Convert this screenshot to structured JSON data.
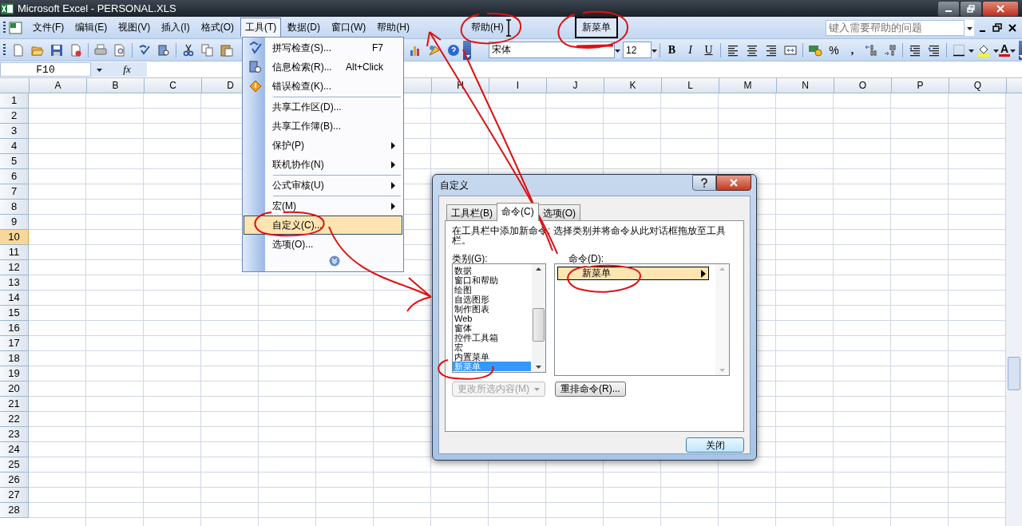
{
  "window": {
    "title": "Microsoft Excel - PERSONAL.XLS"
  },
  "menu_bar": {
    "items": [
      {
        "label": "文件(F)",
        "selected": false
      },
      {
        "label": "编辑(E)",
        "selected": false
      },
      {
        "label": "视图(V)",
        "selected": false
      },
      {
        "label": "插入(I)",
        "selected": false
      },
      {
        "label": "格式(O)",
        "selected": false
      },
      {
        "label": "工具(T)",
        "selected": true
      },
      {
        "label": "数据(D)",
        "selected": false
      },
      {
        "label": "窗口(W)",
        "selected": false
      },
      {
        "label": "帮助(H)",
        "selected": false
      }
    ],
    "custom_items": [
      {
        "label": "帮助(H)",
        "selected": false
      },
      {
        "label": "新菜单",
        "selected": true
      }
    ],
    "help_search": {
      "placeholder": "键入需要帮助的问题"
    }
  },
  "formatting_toolbar": {
    "font": "宋体",
    "size": "12",
    "bold": "B",
    "italic": "I",
    "underline": "U",
    "percent": "%",
    "comma": ",",
    "font_color": "A"
  },
  "formula_bar": {
    "name_box": "F10",
    "function_label": "fx"
  },
  "sheet": {
    "columns": [
      "A",
      "B",
      "C",
      "D",
      null,
      null,
      null,
      "H",
      "I",
      "J",
      "K",
      "L",
      "M",
      "N",
      "O",
      "P",
      "Q"
    ],
    "rows": [
      {
        "label": "1",
        "selected": false
      },
      {
        "label": "2",
        "selected": false
      },
      {
        "label": "3",
        "selected": false
      },
      {
        "label": "4",
        "selected": false
      },
      {
        "label": "5",
        "selected": false
      },
      {
        "label": "6",
        "selected": false
      },
      {
        "label": "7",
        "selected": false
      },
      {
        "label": "8",
        "selected": false
      },
      {
        "label": "9",
        "selected": false
      },
      {
        "label": "10",
        "selected": true
      },
      {
        "label": "11",
        "selected": false
      },
      {
        "label": "12",
        "selected": false
      },
      {
        "label": "13",
        "selected": false
      },
      {
        "label": "14",
        "selected": false
      },
      {
        "label": "15",
        "selected": false
      },
      {
        "label": "16",
        "selected": false
      },
      {
        "label": "17",
        "selected": false
      },
      {
        "label": "18",
        "selected": false
      },
      {
        "label": "19",
        "selected": false
      },
      {
        "label": "20",
        "selected": false
      },
      {
        "label": "21",
        "selected": false
      },
      {
        "label": "22",
        "selected": false
      },
      {
        "label": "23",
        "selected": false
      },
      {
        "label": "24",
        "selected": false
      },
      {
        "label": "25",
        "selected": false
      },
      {
        "label": "26",
        "selected": false
      },
      {
        "label": "27",
        "selected": false
      },
      {
        "label": "28",
        "selected": false
      }
    ]
  },
  "tools_menu": {
    "items": [
      {
        "label": "拼写检查(S)...",
        "shortcut": "F7",
        "submenu": false,
        "separator_before": false,
        "selected": false
      },
      {
        "label": "信息检索(R)...",
        "shortcut": "Alt+Click",
        "submenu": false,
        "separator_before": false,
        "selected": false
      },
      {
        "label": "错误检查(K)...",
        "submenu": false,
        "separator_before": false,
        "selected": false
      },
      {
        "label": "共享工作区(D)...",
        "submenu": false,
        "separator_before": true,
        "selected": false
      },
      {
        "label": "共享工作簿(B)...",
        "submenu": false,
        "separator_before": false,
        "selected": false
      },
      {
        "label": "保护(P)",
        "submenu": true,
        "separator_before": false,
        "selected": false
      },
      {
        "label": "联机协作(N)",
        "submenu": true,
        "separator_before": false,
        "selected": false
      },
      {
        "label": "公式审核(U)",
        "submenu": true,
        "separator_before": true,
        "selected": false
      },
      {
        "label": "宏(M)",
        "submenu": true,
        "separator_before": true,
        "selected": false
      },
      {
        "label": "自定义(C)...",
        "submenu": false,
        "separator_before": false,
        "selected": true
      },
      {
        "label": "选项(O)...",
        "submenu": false,
        "separator_before": false,
        "selected": false
      }
    ]
  },
  "customize_dialog": {
    "title": "自定义",
    "tabs": [
      {
        "label": "工具栏(B)",
        "selected": false
      },
      {
        "label": "命令(C)",
        "selected": true
      },
      {
        "label": "选项(O)",
        "selected": false
      }
    ],
    "instruction": "在工具栏中添加新命令: 选择类别并将命令从此对话框拖放至工具栏。",
    "categories_label": "类别(G):",
    "categories": [
      {
        "label": "数据",
        "selected": false
      },
      {
        "label": "窗口和帮助",
        "selected": false
      },
      {
        "label": "绘图",
        "selected": false
      },
      {
        "label": "自选图形",
        "selected": false
      },
      {
        "label": "制作图表",
        "selected": false
      },
      {
        "label": "Web",
        "selected": false
      },
      {
        "label": "窗体",
        "selected": false
      },
      {
        "label": "控件工具箱",
        "selected": false
      },
      {
        "label": "宏",
        "selected": false
      },
      {
        "label": "内置菜单",
        "selected": false
      },
      {
        "label": "新菜单",
        "selected": true
      }
    ],
    "commands_label": "命令(D):",
    "commands": [
      {
        "label": "新菜单",
        "selected": true,
        "submenu": true
      }
    ],
    "modify_button": {
      "label": "更改所选内容(M)",
      "disabled": true
    },
    "rearrange_button": "重排命令(R)...",
    "close_button": "关闭"
  }
}
